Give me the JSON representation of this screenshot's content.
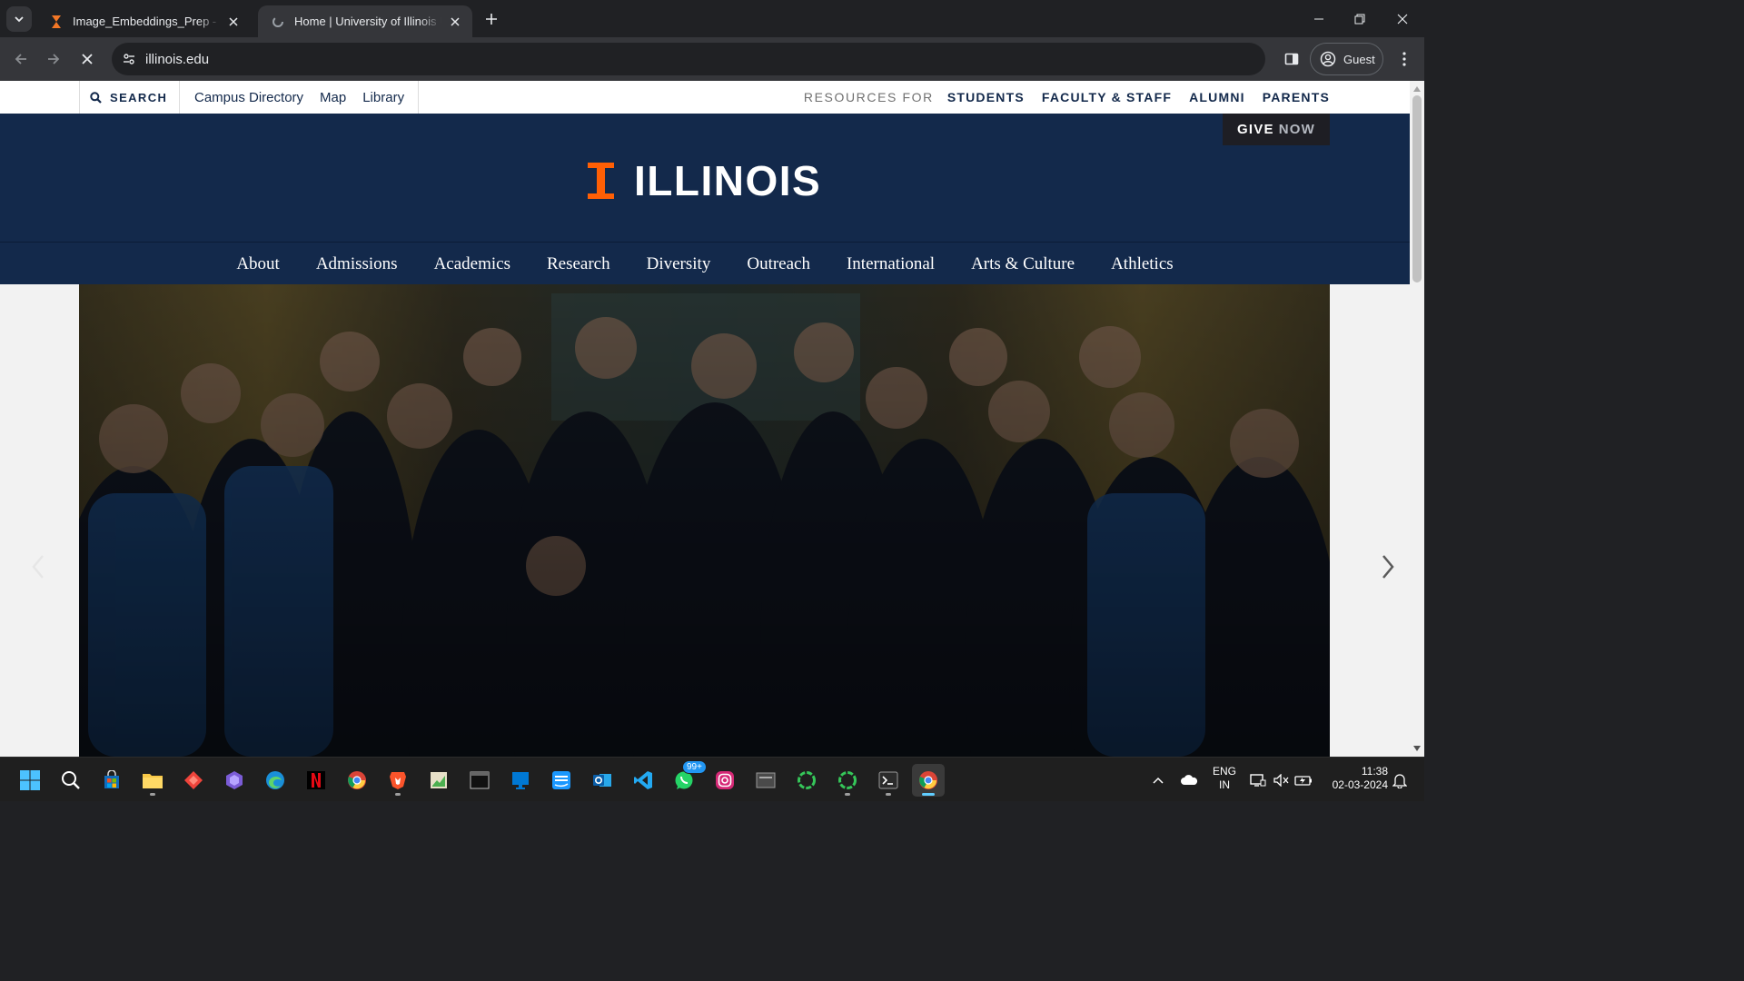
{
  "browser": {
    "tabs": [
      {
        "title": "Image_Embeddings_Prep - Jupyter",
        "state": "inactive",
        "icon": "hourglass-icon"
      },
      {
        "title": "Home | University of Illinois Urbana-Champaign",
        "state": "active",
        "icon": "loading-spinner-icon"
      }
    ],
    "url": "illinois.edu",
    "profile_label": "Guest"
  },
  "page": {
    "utility": {
      "search_label": "SEARCH",
      "links": [
        "Campus Directory",
        "Map",
        "Library"
      ],
      "resources_label": "RESOURCES FOR",
      "resources": [
        "STUDENTS",
        "FACULTY & STAFF",
        "ALUMNI",
        "PARENTS"
      ]
    },
    "give": {
      "give": "GIVE",
      "now": "NOW"
    },
    "wordmark": "ILLINOIS",
    "nav": [
      "About",
      "Admissions",
      "Academics",
      "Research",
      "Diversity",
      "Outreach",
      "International",
      "Arts & Culture",
      "Athletics"
    ]
  },
  "colors": {
    "illinois_blue": "#13294b",
    "illinois_orange": "#ff5f05",
    "chrome_dark": "#202124",
    "chrome_toolbar": "#35363a"
  },
  "taskbar": {
    "notification_badge": "99+",
    "language": [
      "ENG",
      "IN"
    ],
    "time": "11:38",
    "date": "02-03-2024"
  }
}
